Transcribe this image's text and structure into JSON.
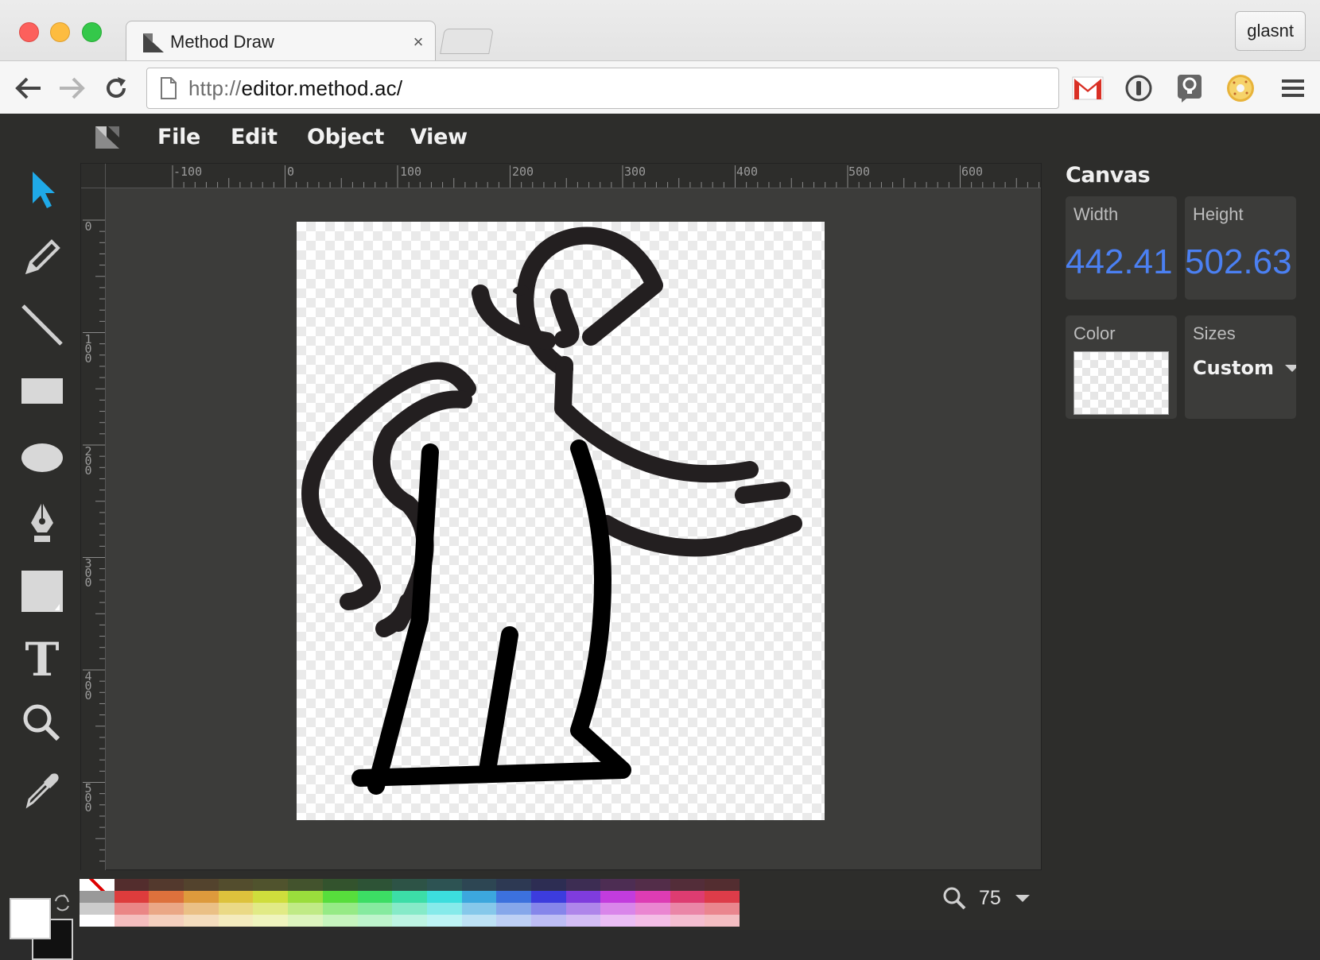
{
  "browser": {
    "tab_title": "Method Draw",
    "tab_close": "×",
    "profile_name": "glasnt",
    "url_protocol": "http://",
    "url_rest": "editor.method.ac/",
    "extensions": [
      "gmail-icon",
      "1password-icon",
      "idea-icon",
      "donut-icon"
    ]
  },
  "menu": {
    "items": [
      "File",
      "Edit",
      "Object",
      "View"
    ]
  },
  "tools": [
    "select-tool",
    "pencil-tool",
    "line-tool",
    "rectangle-tool",
    "ellipse-tool",
    "path-tool",
    "shape-library-tool",
    "text-tool",
    "zoom-tool",
    "eyedropper-tool"
  ],
  "rulers": {
    "top": [
      "-100",
      "0",
      "100",
      "200",
      "300",
      "400",
      "500",
      "600"
    ],
    "left": [
      "0",
      "100",
      "200",
      "300",
      "400",
      "500"
    ]
  },
  "panel": {
    "title": "Canvas",
    "width_label": "Width",
    "width_value": "442.41",
    "height_label": "Height",
    "height_value": "502.63",
    "color_label": "Color",
    "sizes_label": "Sizes",
    "sizes_value": "Custom"
  },
  "zoom": {
    "value": "75"
  },
  "colors": {
    "accent": "#4b80f2",
    "select_tool": "#1fa9e8"
  }
}
